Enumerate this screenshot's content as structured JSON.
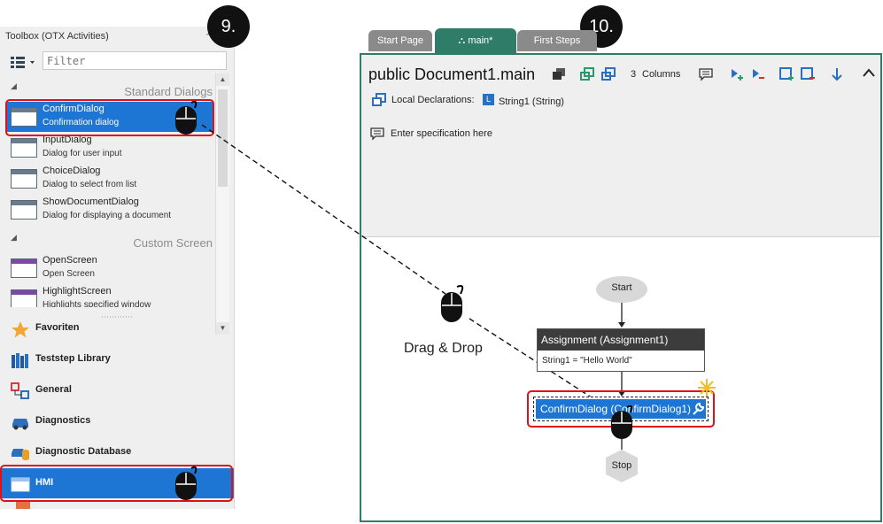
{
  "toolbox": {
    "title": "Toolbox (OTX Activities)",
    "pin": "⩪",
    "filter_placeholder": "Filter",
    "groups": [
      {
        "arrow": "◢",
        "title": "Standard Dialogs"
      },
      {
        "arrow": "◢",
        "title": "Custom Screen"
      }
    ],
    "items": [
      {
        "name": "ConfirmDialog",
        "desc": "Confirmation dialog"
      },
      {
        "name": "InputDialog",
        "desc": "Dialog for user input"
      },
      {
        "name": "ChoiceDialog",
        "desc": "Dialog to select from list"
      },
      {
        "name": "ShowDocumentDialog",
        "desc": "Dialog for displaying a document"
      },
      {
        "name": "OpenScreen",
        "desc": "Open Screen"
      },
      {
        "name": "HighlightScreen",
        "desc": "Highlights specified window"
      }
    ],
    "categories": [
      {
        "label": "Favoriten"
      },
      {
        "label": "Teststep Library"
      },
      {
        "label": "General"
      },
      {
        "label": "Diagnostics"
      },
      {
        "label": "Diagnostic Database"
      },
      {
        "label": "HMI"
      }
    ]
  },
  "badges": {
    "step9": "9.",
    "step10": "10."
  },
  "tabs": [
    {
      "label": "Start Page"
    },
    {
      "label": "main*"
    },
    {
      "label": "First Steps"
    }
  ],
  "editor": {
    "title": "public Document1.main",
    "columns_value": "3",
    "columns_label": "Columns",
    "local_decl_label": "Local Declarations:",
    "decl_badge": "L",
    "decl_value": "String1 (String)",
    "spec_placeholder": "Enter specification here"
  },
  "flow": {
    "start": "Start",
    "assignment_title": "Assignment (Assignment1)",
    "assignment_body": "String1 = \"Hello World\"",
    "confirm": "ConfirmDialog (ConfirmDialog1)",
    "stop": "Stop"
  },
  "annotation": {
    "drag_drop": "Drag & Drop"
  },
  "colors": {
    "accent": "#1e76d4",
    "highlight": "#e0101a",
    "editor_border": "#2f7d69"
  }
}
